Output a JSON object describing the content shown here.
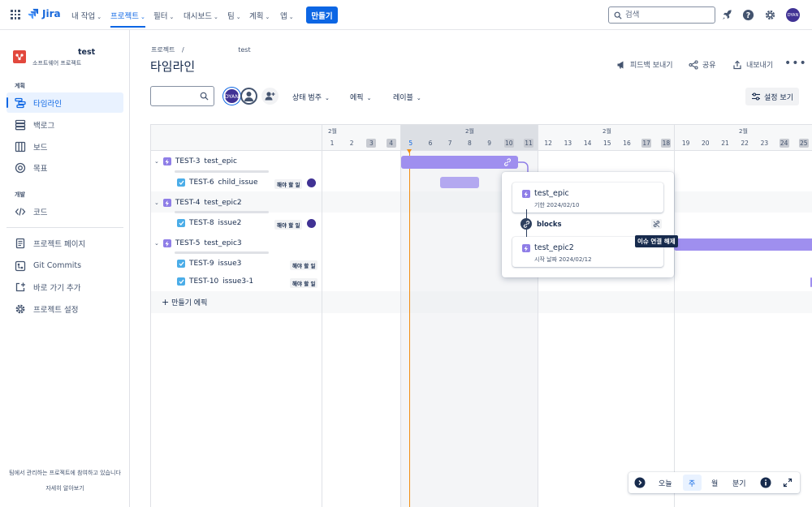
{
  "topnav": {
    "logo": "Jira",
    "items": [
      "내 작업",
      "프로젝트",
      "필터",
      "대시보드",
      "팀",
      "계획",
      "앱"
    ],
    "create": "만들기",
    "search_placeholder": "검색",
    "avatar": "DYAN"
  },
  "sidebar": {
    "project_name": "test",
    "project_type": "소프트웨어 프로젝트",
    "section_planning": "계획",
    "planning_items": [
      "타임라인",
      "백로그",
      "보드",
      "목표"
    ],
    "section_dev": "개발",
    "dev_items": [
      "코드"
    ],
    "other_items": [
      "프로젝트 페이지",
      "Git Commits",
      "바로 가기 추가",
      "프로젝트 설정"
    ],
    "note": "팀에서 관리하는 프로젝트에 참여하고 있습니다",
    "learn_more": "자세히 알아보기"
  },
  "header": {
    "breadcrumb_root": "프로젝트",
    "breadcrumb_sep": "/",
    "breadcrumb_project": "test",
    "title": "타임라인",
    "feedback": "피드백 보내기",
    "share": "공유",
    "export": "내보내기"
  },
  "filters": {
    "avatar1": "DYAN",
    "status": "상태 범주",
    "epic": "에픽",
    "label": "레이블",
    "view_settings": "설정 보기"
  },
  "timeline": {
    "month_label": "2월",
    "days": [
      "1",
      "2",
      "3",
      "4",
      "5",
      "6",
      "7",
      "8",
      "9",
      "10",
      "11",
      "12",
      "13",
      "14",
      "15",
      "16",
      "17",
      "18",
      "19",
      "20",
      "21",
      "22",
      "23",
      "24",
      "25"
    ],
    "weekend_days": [
      "3",
      "4",
      "10",
      "11",
      "17",
      "18",
      "24",
      "25"
    ],
    "today": "5",
    "rows": [
      {
        "type": "epic",
        "key": "TEST-3",
        "summary": "test_epic"
      },
      {
        "type": "task",
        "key": "TEST-6",
        "summary": "child_issue",
        "status": "해야 할 일",
        "avatar": true
      },
      {
        "type": "epic",
        "key": "TEST-4",
        "summary": "test_epic2"
      },
      {
        "type": "task",
        "key": "TEST-8",
        "summary": "issue2",
        "status": "해야 할 일",
        "avatar": true
      },
      {
        "type": "epic",
        "key": "TEST-5",
        "summary": "test_epic3"
      },
      {
        "type": "task",
        "key": "TEST-9",
        "summary": "issue3",
        "status": "해야 할 일",
        "avatar": false
      },
      {
        "type": "task",
        "key": "TEST-10",
        "summary": "issue3-1",
        "status": "해야 할 일",
        "avatar": false
      }
    ],
    "add_epic": "만들기 에픽"
  },
  "popup": {
    "card1_title": "test_epic",
    "card1_sub": "기한 2024/02/10",
    "link_type": "blocks",
    "card2_title": "test_epic2",
    "card2_sub": "시작 날짜 2024/02/12",
    "tooltip": "이슈 연결 해제"
  },
  "zoom": {
    "today": "오늘",
    "week": "주",
    "month": "월",
    "quarter": "분기"
  },
  "colors": {
    "accent": "#0c66e4",
    "epic_bar": "#9f8fef",
    "today_line": "#f18d13"
  }
}
